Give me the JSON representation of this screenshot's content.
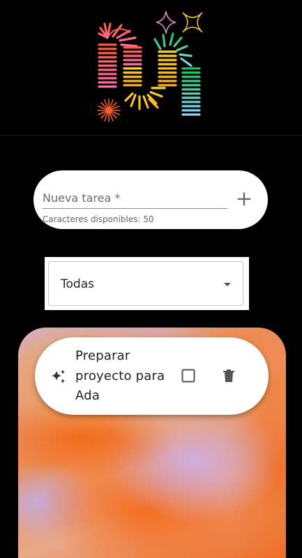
{
  "header": {
    "logo_icon": "colorful-springs-logo-icon"
  },
  "new_task": {
    "placeholder": "Nueva tarea *",
    "value": "",
    "helper_text": "Caracteres disponibles: 50",
    "add_icon": "plus-icon"
  },
  "filter": {
    "selected": "Todas",
    "caret_icon": "caret-down-icon"
  },
  "tasks": [
    {
      "title": "Preparar proyecto para Ada",
      "icon": "sparkle-icon",
      "completed": false,
      "checkbox_icon": "checkbox-empty-icon",
      "delete_icon": "trash-icon"
    }
  ],
  "colors": {
    "background": "#000000",
    "card": "#ffffff",
    "accent_orange": "#f36a1a",
    "accent_lilac": "#cfaee0"
  }
}
